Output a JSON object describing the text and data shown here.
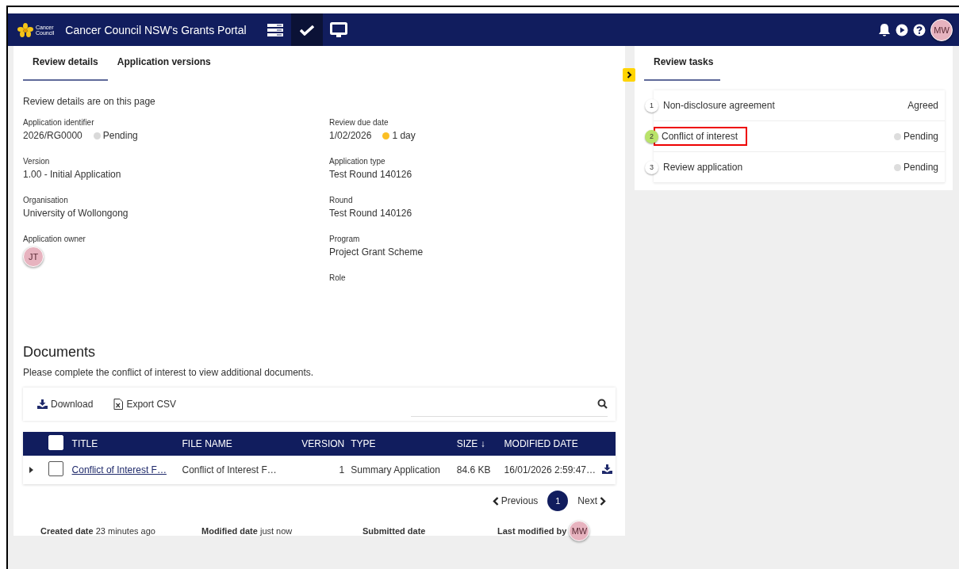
{
  "header": {
    "logo_text": [
      "Cancer",
      "Council"
    ],
    "brand": "Cancer Council NSW's Grants Portal",
    "nav_icons": [
      {
        "kind": "list",
        "selected": false
      },
      {
        "kind": "check",
        "selected": true
      },
      {
        "kind": "monitor",
        "selected": false
      }
    ],
    "actions": [
      {
        "kind": "bell"
      },
      {
        "kind": "play"
      },
      {
        "kind": "help"
      }
    ],
    "user_initials": "MW"
  },
  "tabs": [
    {
      "label": "Review details",
      "selected": true
    },
    {
      "label": "Application versions",
      "selected": false
    }
  ],
  "intro": "Review details are on this page",
  "fields_left": [
    {
      "kind": "text",
      "label": "Application identifier",
      "value": "2026/RG0000",
      "status": {
        "text": "Pending",
        "color": "#d9d9d9"
      }
    },
    {
      "kind": "text",
      "label": "Version",
      "value": "1.00 - Initial Application"
    },
    {
      "kind": "text",
      "label": "Organisation",
      "value": "University of Wollongong"
    },
    {
      "kind": "avatar",
      "label": "Application owner",
      "value": "JT"
    }
  ],
  "fields_right": [
    {
      "kind": "text",
      "label": "Review due date",
      "value": "1/02/2026",
      "status": {
        "text": "1 day",
        "color": "#fbbf24"
      }
    },
    {
      "kind": "text",
      "label": "Application type",
      "value": "Test Round 140126"
    },
    {
      "kind": "text",
      "label": "Round",
      "value": "Test Round 140126"
    },
    {
      "kind": "text",
      "label": "Program",
      "value": "Project Grant Scheme"
    },
    {
      "kind": "text",
      "label": "Role"
    }
  ],
  "documents": {
    "title": "Documents",
    "note": "Please complete the conflict of interest to view additional documents.",
    "toolbar": [
      {
        "kind": "download",
        "label": "Download"
      },
      {
        "kind": "csv",
        "label": "Export CSV"
      }
    ],
    "table": {
      "select_all_checked": false,
      "columns": [
        {
          "label": "TITLE"
        },
        {
          "label": "FILE NAME"
        },
        {
          "label": "VERSION"
        },
        {
          "label": "TYPE"
        },
        {
          "label": "SIZE",
          "sort": "↓"
        },
        {
          "label": "MODIFIED DATE"
        }
      ],
      "rows": [
        {
          "expanded": false,
          "checked": false,
          "title": "Conflict of Interest F…",
          "file_name": "Conflict of Interest F…",
          "version": "1",
          "type": "Summary Application",
          "size": "84.6 KB",
          "modified": "16/01/2026 2:59:47…"
        }
      ]
    },
    "pagination": {
      "previous": "Previous",
      "pages": [
        {
          "label": "1",
          "selected": true
        }
      ],
      "next": "Next"
    }
  },
  "footer": [
    {
      "label": "Created date",
      "value": "23 minutes ago"
    },
    {
      "label": "Modified date",
      "value": "just now"
    },
    {
      "label": "Submitted date"
    },
    {
      "label": "Last modified by",
      "avatar": "MW"
    }
  ],
  "tasks": {
    "tab": {
      "label": "Review tasks",
      "selected": true
    },
    "items": [
      {
        "number": "1",
        "name": "Non-disclosure agreement",
        "status": "Agreed",
        "status_dot": false,
        "current": false,
        "highlighted": false
      },
      {
        "number": "2",
        "name": "Conflict of interest",
        "status": "Pending",
        "status_dot": true,
        "current": true,
        "highlighted": true
      },
      {
        "number": "3",
        "name": "Review application",
        "status": "Pending",
        "status_dot": true,
        "current": false,
        "highlighted": false
      }
    ]
  }
}
